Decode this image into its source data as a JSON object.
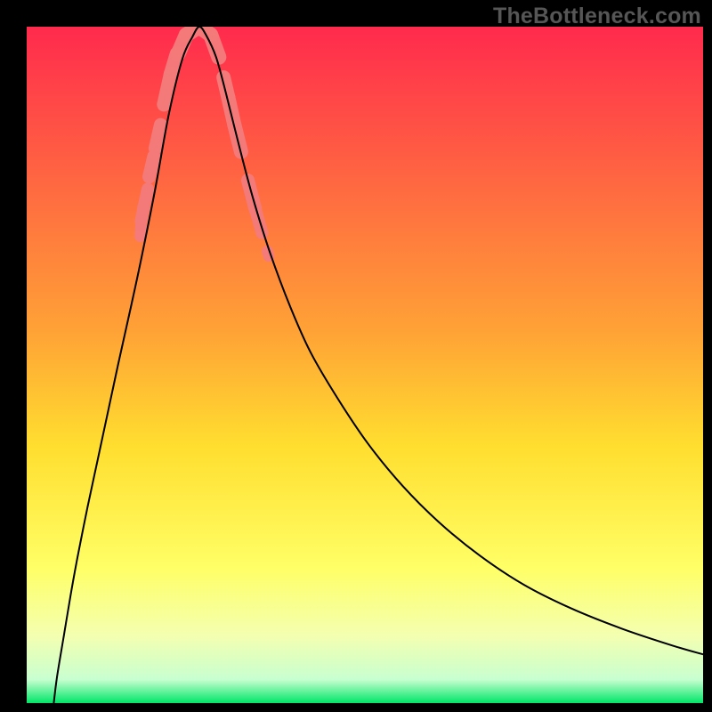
{
  "watermark": "TheBottleneck.com",
  "chart_data": {
    "type": "line",
    "title": "",
    "xlabel": "",
    "ylabel": "",
    "xlim": [
      0,
      1
    ],
    "ylim": [
      0,
      1
    ],
    "x_ideal_normalized": 0.255,
    "background_gradient_stops": [
      {
        "offset": 0.0,
        "color": "#ff2a4d"
      },
      {
        "offset": 0.45,
        "color": "#ffa236"
      },
      {
        "offset": 0.62,
        "color": "#ffde2f"
      },
      {
        "offset": 0.8,
        "color": "#ffff66"
      },
      {
        "offset": 0.9,
        "color": "#f4ffb0"
      },
      {
        "offset": 0.965,
        "color": "#c8ffd0"
      },
      {
        "offset": 1.0,
        "color": "#00e668"
      }
    ],
    "series": [
      {
        "name": "bottleneck-curve",
        "points_normalized": [
          [
            0.04,
            0.0
          ],
          [
            0.045,
            0.04
          ],
          [
            0.055,
            0.1
          ],
          [
            0.065,
            0.16
          ],
          [
            0.075,
            0.215
          ],
          [
            0.09,
            0.29
          ],
          [
            0.105,
            0.36
          ],
          [
            0.12,
            0.43
          ],
          [
            0.135,
            0.5
          ],
          [
            0.155,
            0.59
          ],
          [
            0.17,
            0.66
          ],
          [
            0.19,
            0.76
          ],
          [
            0.21,
            0.87
          ],
          [
            0.23,
            0.952
          ],
          [
            0.245,
            0.985
          ],
          [
            0.255,
            1.0
          ],
          [
            0.265,
            0.988
          ],
          [
            0.28,
            0.955
          ],
          [
            0.295,
            0.9
          ],
          [
            0.315,
            0.82
          ],
          [
            0.335,
            0.745
          ],
          [
            0.36,
            0.665
          ],
          [
            0.39,
            0.585
          ],
          [
            0.42,
            0.518
          ],
          [
            0.46,
            0.45
          ],
          [
            0.505,
            0.383
          ],
          [
            0.555,
            0.322
          ],
          [
            0.61,
            0.267
          ],
          [
            0.67,
            0.218
          ],
          [
            0.735,
            0.175
          ],
          [
            0.805,
            0.14
          ],
          [
            0.88,
            0.11
          ],
          [
            0.955,
            0.085
          ],
          [
            1.0,
            0.072
          ]
        ]
      }
    ],
    "highlight_threshold_normalized": 0.68,
    "highlight_segments_normalized": [
      {
        "x1": 0.168,
        "y1": 0.69,
        "x2": 0.169,
        "y2": 0.707,
        "w": 13
      },
      {
        "x1": 0.169,
        "y1": 0.712,
        "x2": 0.173,
        "y2": 0.733,
        "w": 14
      },
      {
        "x1": 0.173,
        "y1": 0.733,
        "x2": 0.179,
        "y2": 0.76,
        "w": 14
      },
      {
        "x1": 0.181,
        "y1": 0.778,
        "x2": 0.188,
        "y2": 0.808,
        "w": 15
      },
      {
        "x1": 0.19,
        "y1": 0.82,
        "x2": 0.198,
        "y2": 0.855,
        "w": 15
      },
      {
        "x1": 0.203,
        "y1": 0.885,
        "x2": 0.213,
        "y2": 0.93,
        "w": 16
      },
      {
        "x1": 0.213,
        "y1": 0.93,
        "x2": 0.222,
        "y2": 0.96,
        "w": 16
      },
      {
        "x1": 0.224,
        "y1": 0.96,
        "x2": 0.236,
        "y2": 0.988,
        "w": 17
      },
      {
        "x1": 0.236,
        "y1": 0.988,
        "x2": 0.255,
        "y2": 1.0,
        "w": 17
      },
      {
        "x1": 0.255,
        "y1": 1.0,
        "x2": 0.272,
        "y2": 0.988,
        "w": 17
      },
      {
        "x1": 0.272,
        "y1": 0.988,
        "x2": 0.284,
        "y2": 0.955,
        "w": 17
      },
      {
        "x1": 0.291,
        "y1": 0.925,
        "x2": 0.298,
        "y2": 0.895,
        "w": 16
      },
      {
        "x1": 0.298,
        "y1": 0.895,
        "x2": 0.307,
        "y2": 0.855,
        "w": 16
      },
      {
        "x1": 0.307,
        "y1": 0.855,
        "x2": 0.317,
        "y2": 0.815,
        "w": 16
      },
      {
        "x1": 0.327,
        "y1": 0.773,
        "x2": 0.338,
        "y2": 0.73,
        "w": 15
      },
      {
        "x1": 0.338,
        "y1": 0.73,
        "x2": 0.348,
        "y2": 0.695,
        "w": 14
      },
      {
        "x1": 0.356,
        "y1": 0.668,
        "x2": 0.358,
        "y2": 0.661,
        "w": 13
      }
    ],
    "highlight_color": "#f47b7b"
  }
}
